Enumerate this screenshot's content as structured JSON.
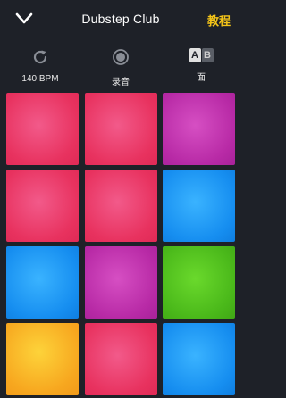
{
  "header": {
    "title": "Dubstep Club",
    "tutorial_label": "教程"
  },
  "toolbar": {
    "bpm_label": "140 BPM",
    "record_label": "录音",
    "side_label": "面",
    "side_a": "A",
    "side_b": "B"
  },
  "colors": {
    "background": "#1e2128",
    "accent": "#f5c518",
    "pink": "#e8325f",
    "purple": "#b82aa6",
    "blue": "#168ef0",
    "green": "#4ab81a",
    "yellow": "#f7a71f"
  },
  "pads": [
    [
      "pink",
      "pink",
      "purple"
    ],
    [
      "pink",
      "pink",
      "blue"
    ],
    [
      "blue",
      "purple",
      "green"
    ],
    [
      "yellow",
      "pink",
      "blue"
    ]
  ]
}
